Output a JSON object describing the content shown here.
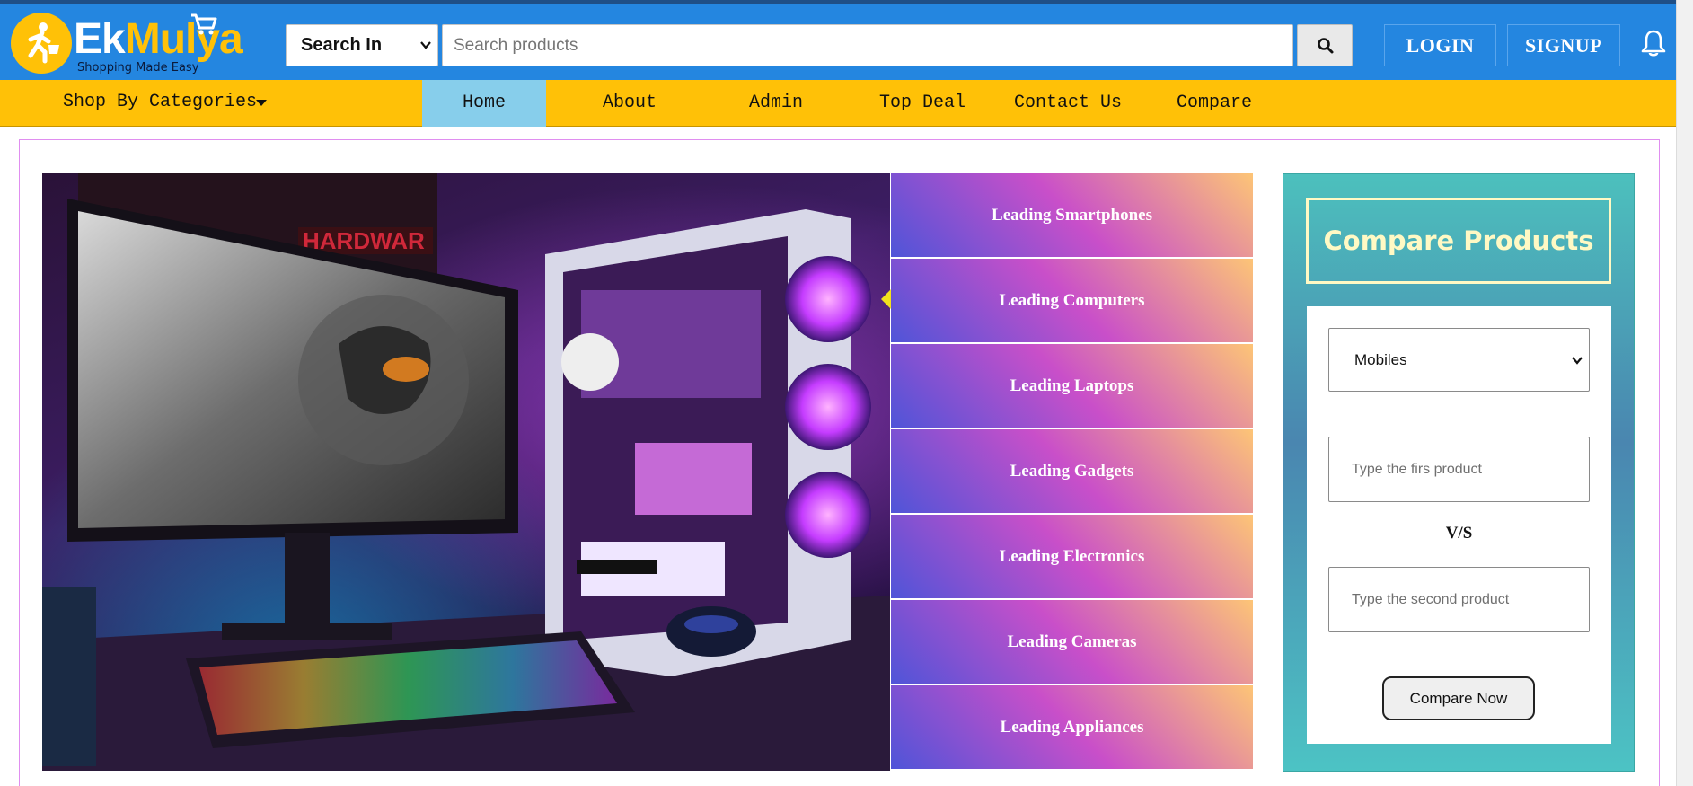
{
  "header": {
    "logo_text_part1": "Ek",
    "logo_text_part2": "Mulya",
    "logo_tagline": "Shopping Made Easy",
    "search_scope": "Search In",
    "search_placeholder": "Search products",
    "login_label": "LOGIN",
    "signup_label": "SIGNUP"
  },
  "nav": {
    "categories_label": "Shop By Categories",
    "items": [
      {
        "label": "Home",
        "active": true
      },
      {
        "label": "About",
        "active": false
      },
      {
        "label": "Admin",
        "active": false
      },
      {
        "label": "Top Deal",
        "active": false
      },
      {
        "label": "Contact Us",
        "active": false
      },
      {
        "label": "Compare",
        "active": false
      }
    ]
  },
  "categories": [
    "Leading Smartphones",
    "Leading Computers",
    "Leading Laptops",
    "Leading Gadgets",
    "Leading Electronics",
    "Leading Cameras",
    "Leading Appliances"
  ],
  "hero": {
    "monitor_brand": "HARDWAR"
  },
  "compare": {
    "title": "Compare Products",
    "category_value": "Mobiles",
    "first_placeholder": "Type the firs product",
    "vs_label": "V/S",
    "second_placeholder": "Type the second product",
    "button_label": "Compare Now"
  },
  "colors": {
    "header_bg": "#2486e0",
    "nav_bg": "#ffc107",
    "nav_active_bg": "#87ceeb",
    "category_gradient_start": "#4f54d8",
    "category_gradient_mid": "#c94fc9",
    "category_gradient_end": "#fdc576",
    "compare_panel_bg": "#4cc0bd",
    "compare_title_color": "#fff9c4"
  },
  "icons": {
    "search": "search-icon",
    "notifications": "bell-icon",
    "dropdown": "chevron-down-icon",
    "logo_cart": "cart-icon"
  }
}
